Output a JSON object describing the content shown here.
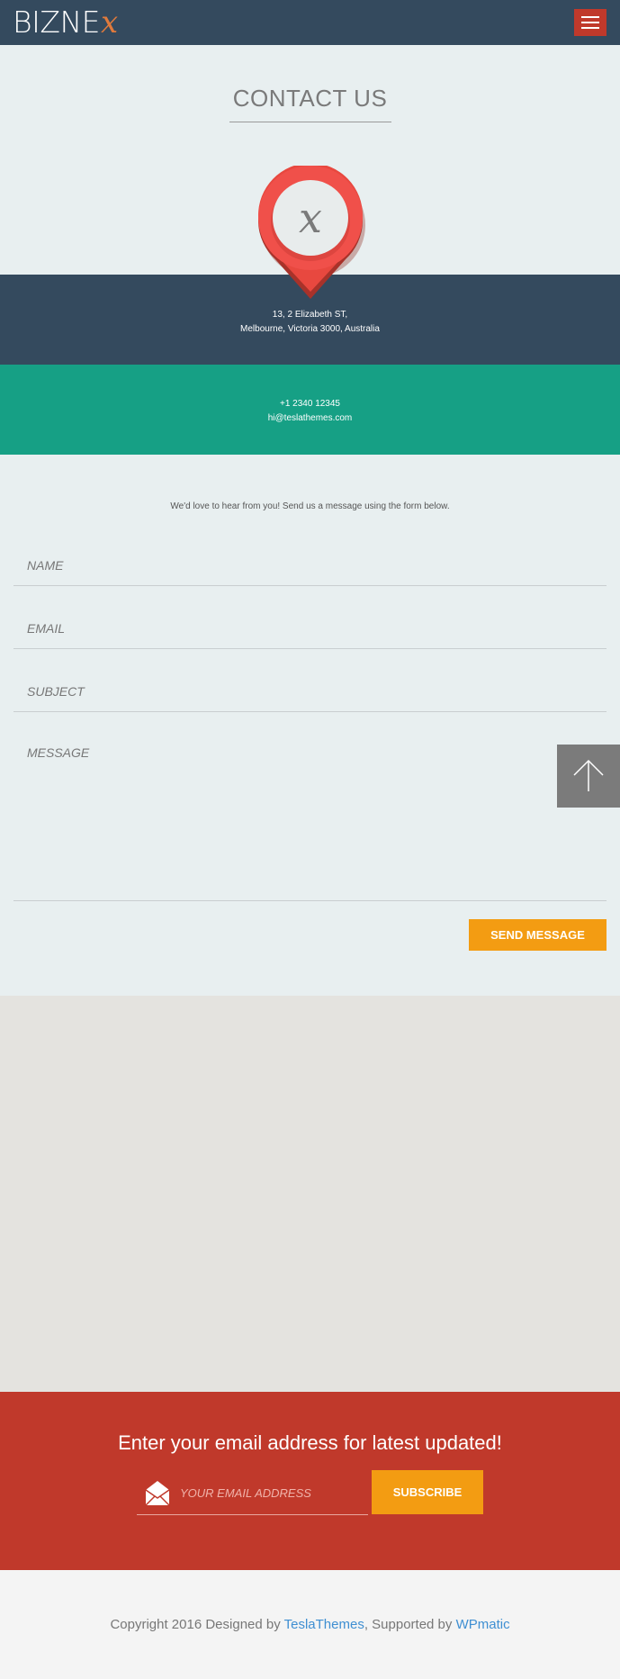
{
  "header": {
    "logo_text": "BIZNE",
    "logo_accent": "x",
    "menu_icon": "hamburger-icon"
  },
  "contact": {
    "title": "CONTACT US",
    "address_line1": "13, 2 Elizabeth ST,",
    "address_line2": "Melbourne, Victoria 3000, Australia",
    "phone": "+1 2340 12345",
    "email": "hi@teslathemes.com",
    "pin_icon": "map-pin-icon"
  },
  "form": {
    "intro": "We'd love to hear from you! Send us a message using the form below.",
    "name_placeholder": "NAME",
    "email_placeholder": "EMAIL",
    "subject_placeholder": "SUBJECT",
    "message_placeholder": "MESSAGE",
    "send_label": "SEND MESSAGE"
  },
  "back_to_top_icon": "arrow-up-icon",
  "subscribe": {
    "title": "Enter your email address for latest updated!",
    "email_placeholder": "YOUR EMAIL ADDRESS",
    "button_label": "SUBSCRIBE",
    "mail_icon": "envelope-icon"
  },
  "footer": {
    "prefix": "Copyright 2016 Designed by ",
    "link1": "TeslaThemes",
    "middle": ", Supported by ",
    "link2": "WPmatic"
  },
  "colors": {
    "header_bg": "#344a5e",
    "accent_red": "#c0392b",
    "teal": "#16a085",
    "orange": "#f39c12",
    "link_blue": "#3f8fd2"
  }
}
